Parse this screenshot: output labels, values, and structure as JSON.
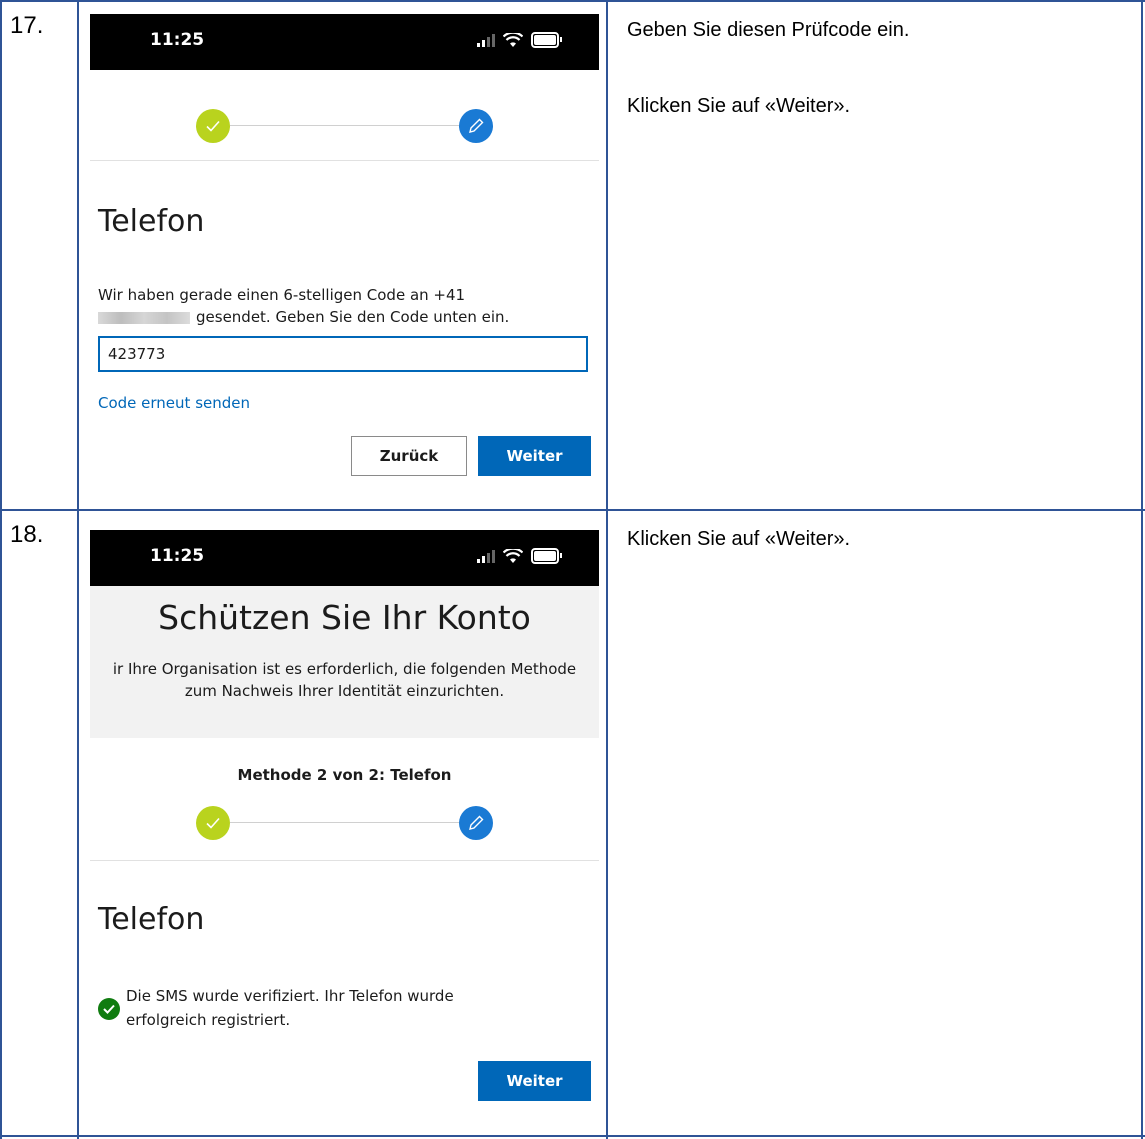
{
  "steps": [
    {
      "number": "17.",
      "instructions": [
        "Geben Sie diesen Prüfcode ein.",
        "Klicken Sie auf «Weiter»."
      ],
      "phone": {
        "time": "11:25",
        "heading": "Telefon",
        "message_line1": "Wir haben gerade einen 6-stelligen Code an +41",
        "message_line2": "gesendet. Geben Sie den Code unten ein.",
        "code_value": "423773",
        "resend_link": "Code erneut senden",
        "back_button": "Zurück",
        "next_button": "Weiter"
      }
    },
    {
      "number": "18.",
      "instructions": [
        "Klicken Sie auf «Weiter»."
      ],
      "phone": {
        "time": "11:25",
        "title": "Schützen Sie Ihr Konto",
        "subtitle_line1": "ir Ihre Organisation ist es erforderlich, die folgenden Methode",
        "subtitle_line2": "zum Nachweis Ihrer Identität einzurichten.",
        "method_label": "Methode 2 von 2: Telefon",
        "heading": "Telefon",
        "verified_line1": "Die SMS wurde verifiziert. Ihr Telefon wurde",
        "verified_line2": "erfolgreich registriert.",
        "next_button": "Weiter"
      }
    }
  ],
  "colors": {
    "table_border": "#2f5496",
    "primary_button": "#0067b8",
    "step_done": "#b9d31e",
    "step_current": "#1a7ad4",
    "success": "#107c10"
  },
  "icons": [
    "signal-icon",
    "wifi-icon",
    "battery-icon",
    "check-icon",
    "pencil-icon",
    "success-check-icon"
  ]
}
